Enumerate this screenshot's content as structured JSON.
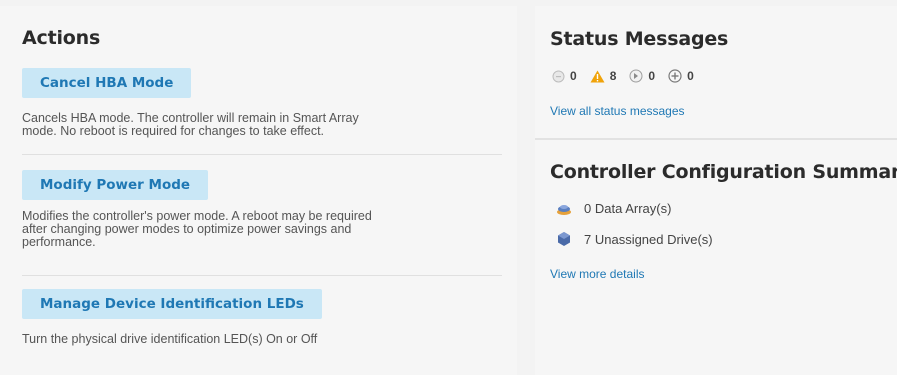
{
  "actions": {
    "title": "Actions",
    "items": [
      {
        "button": "Cancel HBA Mode",
        "description_line1": "Cancels HBA mode. The controller will remain in Smart Array",
        "description_line2": "mode. No reboot is required for changes to take effect.",
        "description_line3": ""
      },
      {
        "button": "Modify Power Mode",
        "description_line1": "Modifies the controller's power mode. A reboot may be required",
        "description_line2": "after changing power modes to optimize power savings and",
        "description_line3": "performance."
      },
      {
        "button": "Manage Device Identification LEDs",
        "description_line1": "Turn the physical drive identification LED(s) On or Off",
        "description_line2": "",
        "description_line3": ""
      }
    ]
  },
  "status": {
    "title": "Status Messages",
    "counts": [
      {
        "icon": "info-gray-icon",
        "value": "0"
      },
      {
        "icon": "warning-triangle-icon",
        "value": "8"
      },
      {
        "icon": "critical-icon",
        "value": "0"
      },
      {
        "icon": "ok-plus-icon",
        "value": "0"
      }
    ],
    "link": "View all status messages"
  },
  "summary": {
    "title": "Controller Configuration Summary",
    "rows": [
      {
        "icon": "data-array-icon",
        "text": "0 Data Array(s)"
      },
      {
        "icon": "unassigned-drive-icon",
        "text": "7 Unassigned Drive(s)"
      }
    ],
    "link": "View more details"
  },
  "colors": {
    "accent": "#1f78b4",
    "button_bg": "#c9e7f6",
    "warning": "#f0a30a"
  }
}
